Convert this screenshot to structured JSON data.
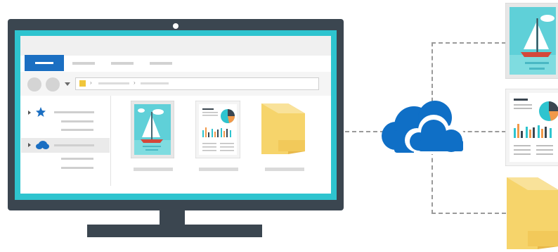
{
  "illustration": {
    "subject": "",
    "icons": [
      "desktop-monitor-icon",
      "onedrive-cloud-icon",
      "sailboat-picture-icon",
      "document-with-charts-icon",
      "folder-icon"
    ]
  },
  "colors": {
    "bezel": "#3b4650",
    "screen_accent": "#2ec4cf",
    "selected_tab": "#1b6fc2",
    "cloud": "#0f6fc6",
    "folder": "#f6d46b",
    "folder_dark": "#e8b84a",
    "sky": "#5fd0d8",
    "sea": "#7fdce0",
    "boat_hull": "#d4473b",
    "chart_teal": "#2ec4cf",
    "chart_orange": "#f2994a",
    "chart_dark": "#3b4650",
    "dash": "#9a9a9a"
  },
  "explorer_window": {
    "ribbon_tabs": [
      "",
      "",
      "",
      ""
    ],
    "address_path": [
      "",
      ""
    ],
    "sidebar_items": [
      {
        "icon": "pin-star-icon",
        "label": "",
        "sub_items": [
          "",
          ""
        ]
      },
      {
        "icon": "onedrive-cloud-icon",
        "label": "",
        "sub_items": [
          "",
          ""
        ],
        "selected": true
      }
    ],
    "files": [
      {
        "icon": "sailboat-picture-icon",
        "caption": ""
      },
      {
        "icon": "document-with-charts-icon",
        "caption": ""
      },
      {
        "icon": "folder-icon",
        "caption": ""
      }
    ]
  },
  "cloud_targets": [
    {
      "icon": "sailboat-picture-icon"
    },
    {
      "icon": "document-with-charts-icon"
    },
    {
      "icon": "folder-icon"
    }
  ]
}
